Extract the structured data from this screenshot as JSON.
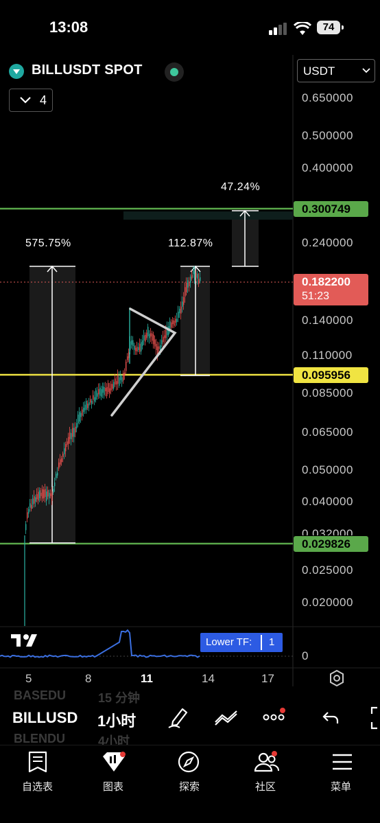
{
  "status_bar": {
    "time": "13:08",
    "battery": "74"
  },
  "header": {
    "symbol": "BILLUSDT SPOT",
    "collapse_count": "4",
    "quote_currency": "USDT"
  },
  "price_axis": {
    "labels": [
      "0.650000",
      "0.500000",
      "0.400000",
      "0.240000",
      "0.140000",
      "0.110000",
      "0.085000",
      "0.065000",
      "0.050000",
      "0.040000",
      "0.032000",
      "0.025000",
      "0.020000"
    ],
    "upper_level": "0.300749",
    "current_price": "0.182200",
    "countdown": "51:23",
    "middle_level": "0.095956",
    "lower_level": "0.029826",
    "indicator_zero": "0"
  },
  "measurements": {
    "left_pct": "575.75%",
    "right_pct": "112.87%",
    "projection_pct": "47.24%"
  },
  "time_axis": {
    "labels": [
      "5",
      "8",
      "11",
      "14",
      "17"
    ]
  },
  "lower_tf": {
    "label": "Lower TF:",
    "value": "1"
  },
  "toolbar": {
    "symbol": "BILLUSD",
    "interval": "1小时",
    "ghost_above_symbol": "BASEDU",
    "ghost_below_symbol": "BLENDU",
    "ghost_above_interval": "15 分钟",
    "ghost_below_interval": "4小时"
  },
  "bottom_nav": {
    "items": [
      {
        "label": "自选表"
      },
      {
        "label": "图表"
      },
      {
        "label": "探索"
      },
      {
        "label": "社区"
      },
      {
        "label": "菜单"
      }
    ]
  },
  "colors": {
    "up": "#2bb5a5",
    "down": "#f05350",
    "green_line": "#5aa84a",
    "yellow_line": "#f0e442",
    "price_red": "#e25b57",
    "accent_blue": "#2d5be3"
  }
}
